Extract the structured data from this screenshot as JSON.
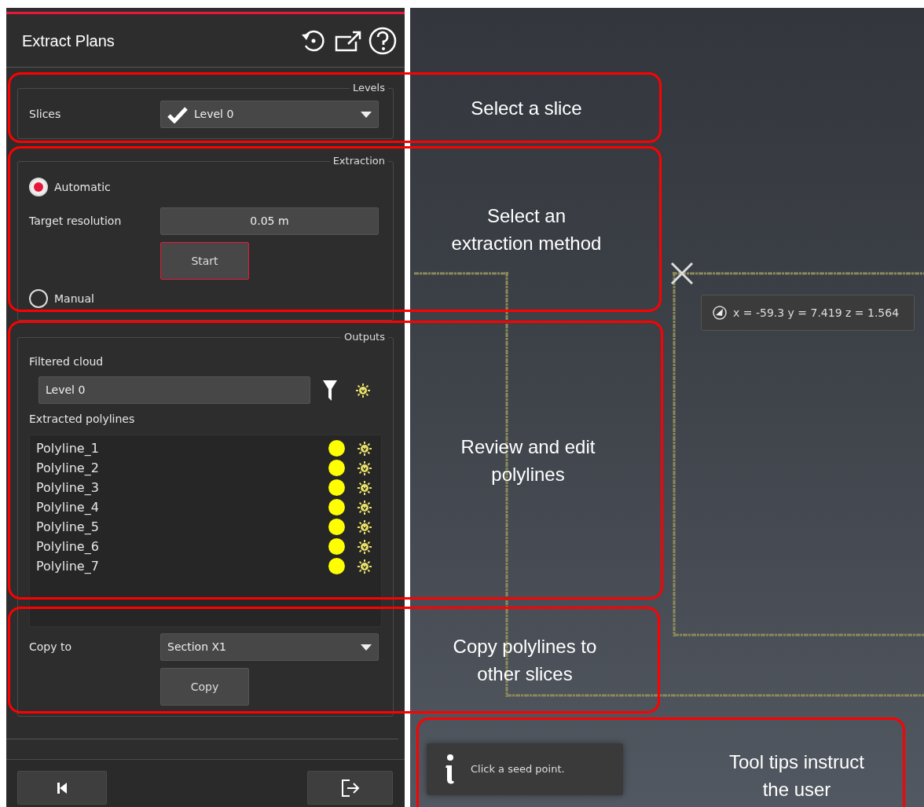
{
  "panel": {
    "title": "Extract Plans",
    "levels": {
      "legend": "Levels",
      "slices_label": "Slices",
      "slice_value": "Level 0",
      "slice_checked": true
    },
    "extraction": {
      "legend": "Extraction",
      "methods": [
        {
          "label": "Automatic",
          "selected": true
        },
        {
          "label": "Manual",
          "selected": false
        }
      ],
      "resolution_label": "Target resolution",
      "resolution_value": "0.05 m",
      "start_button": {
        "label": "Start",
        "focused": true
      }
    },
    "outputs": {
      "legend": "Outputs",
      "filtered_label": "Filtered cloud",
      "filtered_value": "Level 0",
      "polylines_label": "Extracted polylines",
      "polylines": [
        {
          "name": "Polyline_1"
        },
        {
          "name": "Polyline_2"
        },
        {
          "name": "Polyline_3"
        },
        {
          "name": "Polyline_4"
        },
        {
          "name": "Polyline_5"
        },
        {
          "name": "Polyline_6"
        },
        {
          "name": "Polyline_7"
        }
      ]
    },
    "copy": {
      "label": "Copy to",
      "value": "Section X1",
      "button": "Copy"
    }
  },
  "viewport": {
    "coordinates": "x = -59.3 y = 7.419 z = 1.564",
    "tooltip": "Click a seed point."
  },
  "callouts": [
    {
      "text": "Select a slice"
    },
    {
      "text": "Select an\nextraction method"
    },
    {
      "text": "Review and edit\npolylines"
    },
    {
      "text": "Copy polylines to\nother slices"
    },
    {
      "text": "Tool tips instruct\nthe user"
    }
  ]
}
